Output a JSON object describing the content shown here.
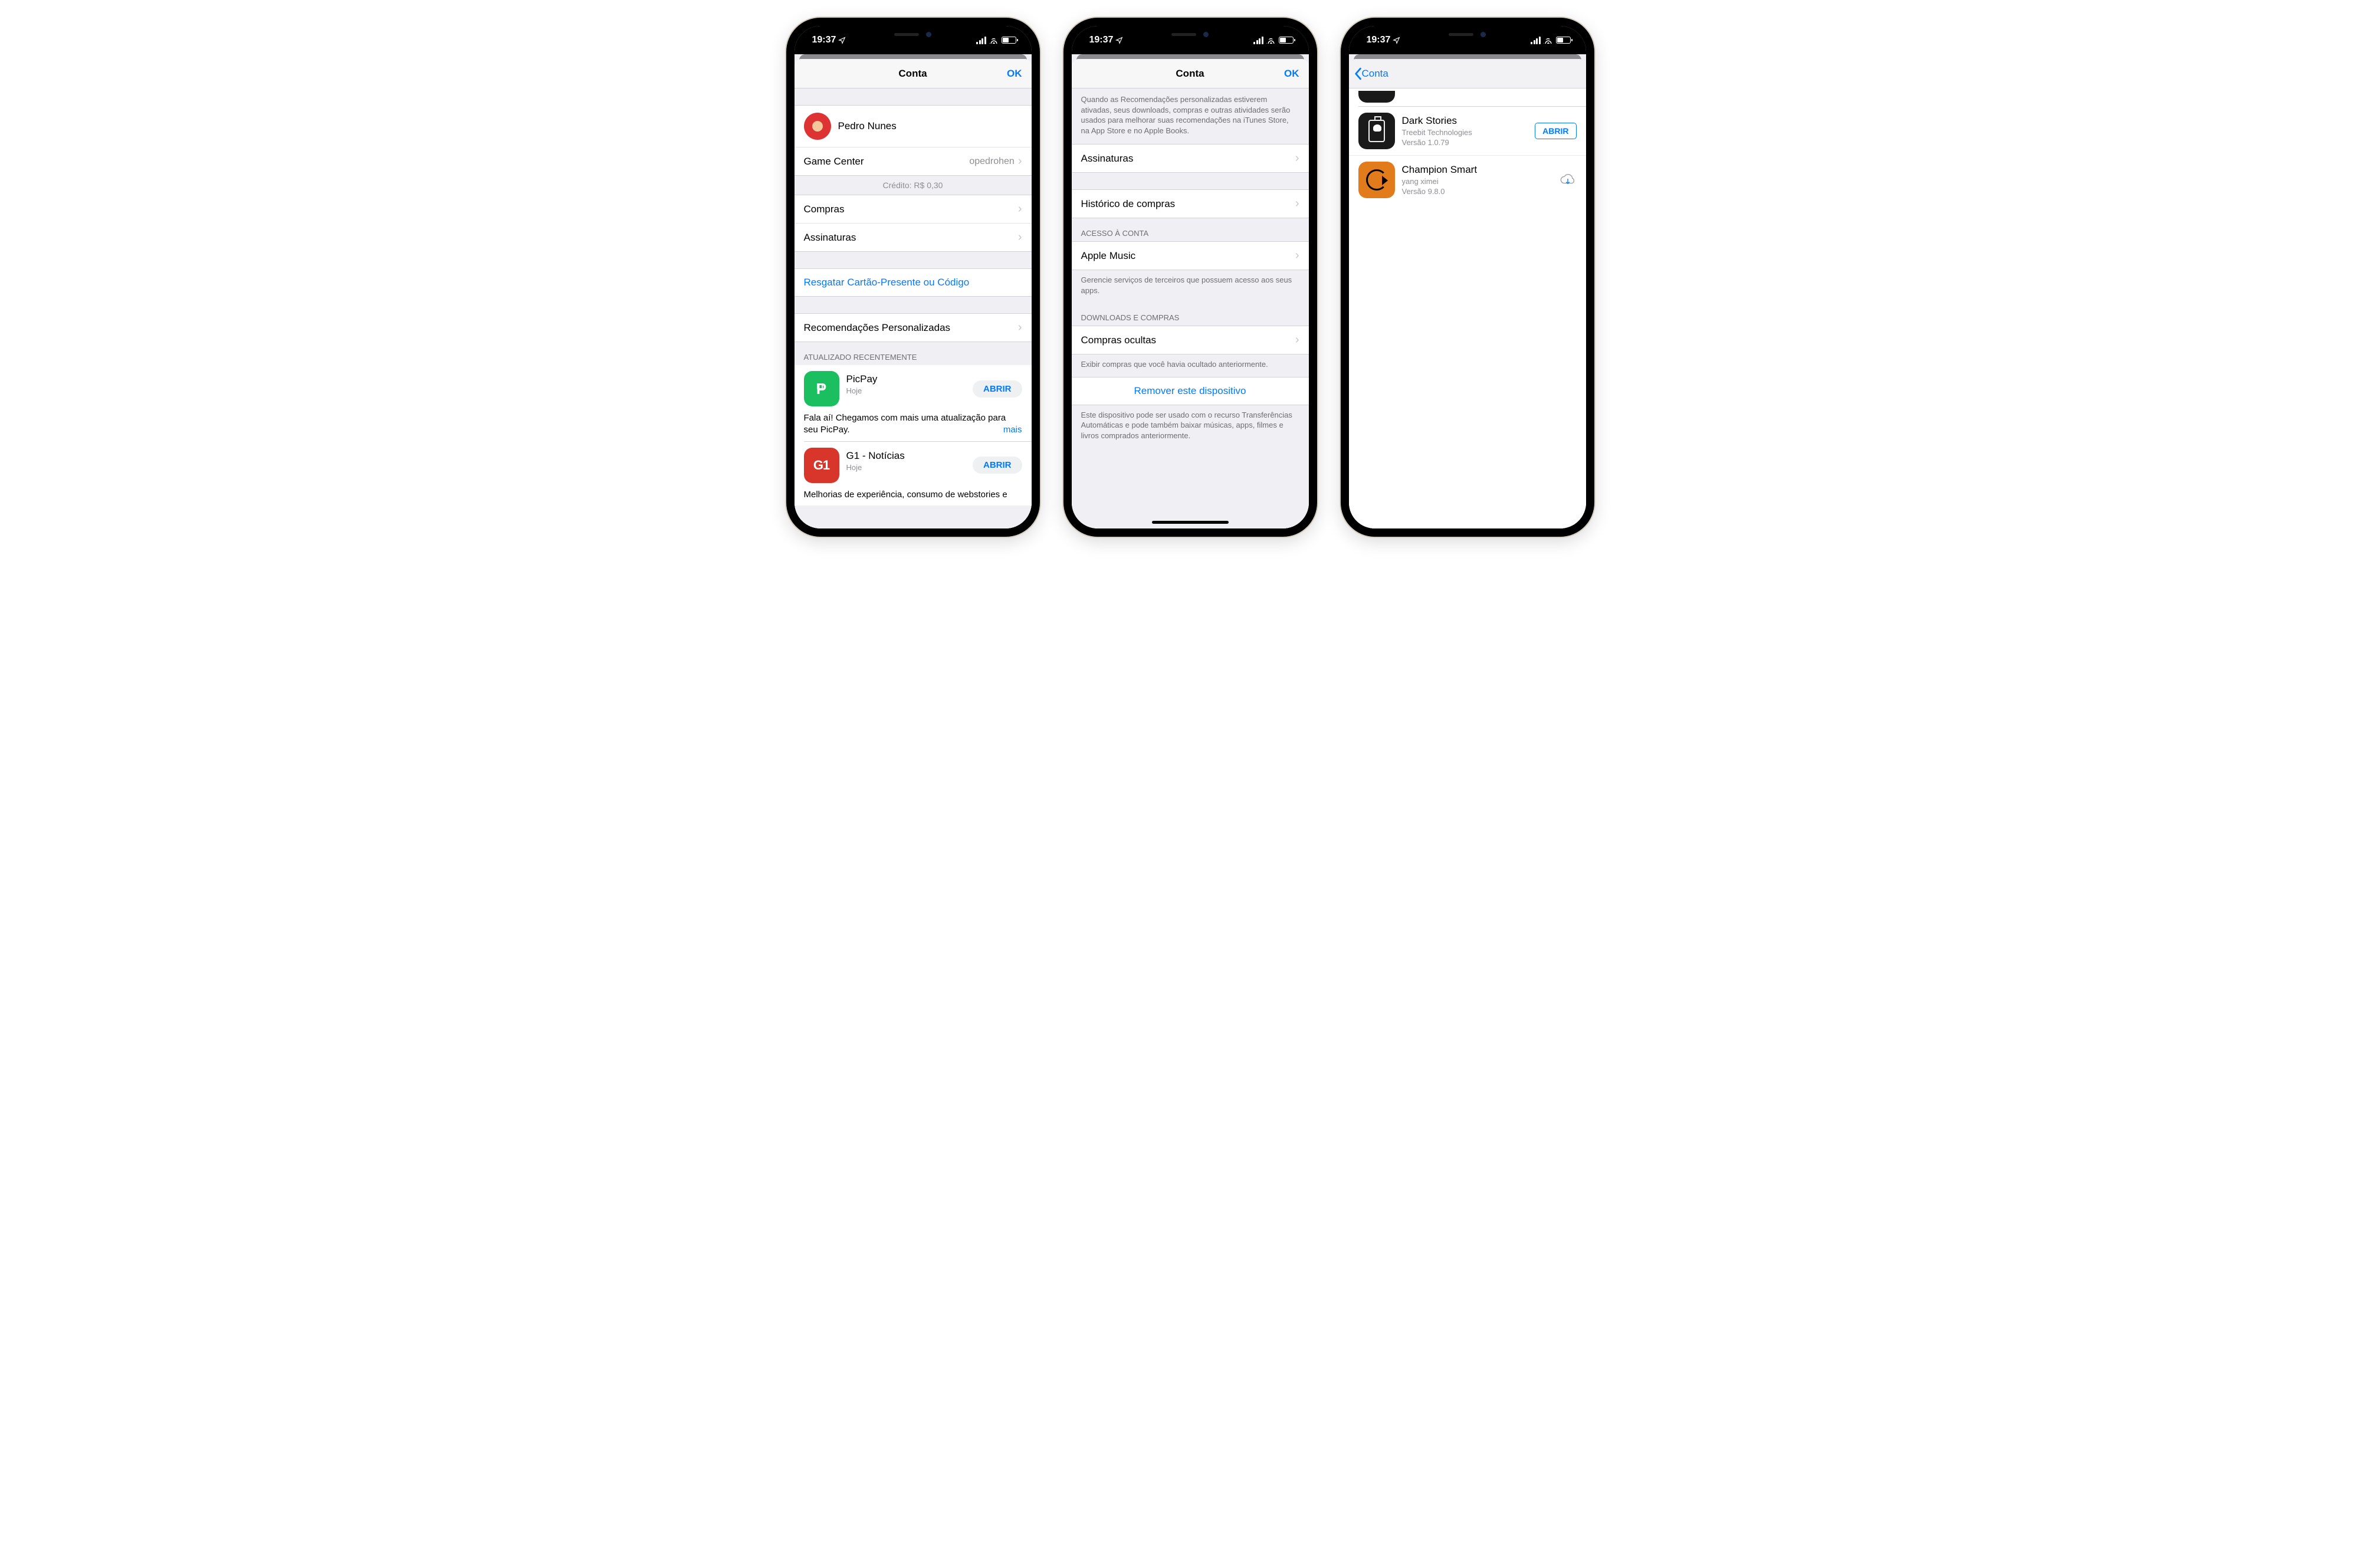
{
  "status": {
    "time": "19:37"
  },
  "screen1": {
    "nav": {
      "title": "Conta",
      "ok": "OK"
    },
    "profile_name": "Pedro Nunes",
    "gamecenter_label": "Game Center",
    "gamecenter_value": "opedrohen",
    "credit": "Crédito: R$ 0,30",
    "rows": {
      "compras": "Compras",
      "assinaturas": "Assinaturas",
      "resgatar": "Resgatar Cartão-Presente ou Código",
      "recomendacoes": "Recomendações Personalizadas"
    },
    "updated_header": "ATUALIZADO RECENTEMENTE",
    "apps": {
      "picpay": {
        "name": "PicPay",
        "sub": "Hoje",
        "action": "ABRIR",
        "desc": "Fala aí! Chegamos com mais uma atualização para seu PicPay.",
        "more": "mais"
      },
      "g1": {
        "name": "G1 - Notícias",
        "sub": "Hoje",
        "action": "ABRIR",
        "desc": "Melhorias de experiência, consumo de webstories e"
      }
    }
  },
  "screen2": {
    "nav": {
      "title": "Conta",
      "ok": "OK"
    },
    "top_para": "Quando as Recomendações personalizadas estiverem ativadas, seus downloads, compras e outras atividades serão usados para melhorar suas recomendações na iTunes Store, na App Store e no Apple Books.",
    "rows": {
      "assinaturas": "Assinaturas",
      "historico": "Histórico de compras",
      "apple_music": "Apple Music",
      "compras_ocultas": "Compras ocultas",
      "remover": "Remover este dispositivo"
    },
    "headers": {
      "acesso": "ACESSO À CONTA",
      "downloads": "DOWNLOADS E COMPRAS"
    },
    "footers": {
      "acesso": "Gerencie serviços de terceiros que possuem acesso aos seus apps.",
      "ocultas": "Exibir compras que você havia ocultado anteriormente.",
      "remover": "Este dispositivo pode ser usado com o recurso Transferências Automáticas e pode também baixar músicas, apps, filmes e livros comprados anteriormente."
    }
  },
  "screen3": {
    "nav": {
      "back": "Conta"
    },
    "apps": {
      "dark": {
        "name": "Dark Stories",
        "pub": "Treebit Technologies",
        "ver": "Versão 1.0.79",
        "action": "ABRIR"
      },
      "champ": {
        "name": "Champion Smart",
        "pub": "yang ximei",
        "ver": "Versão 9.8.0"
      }
    }
  }
}
